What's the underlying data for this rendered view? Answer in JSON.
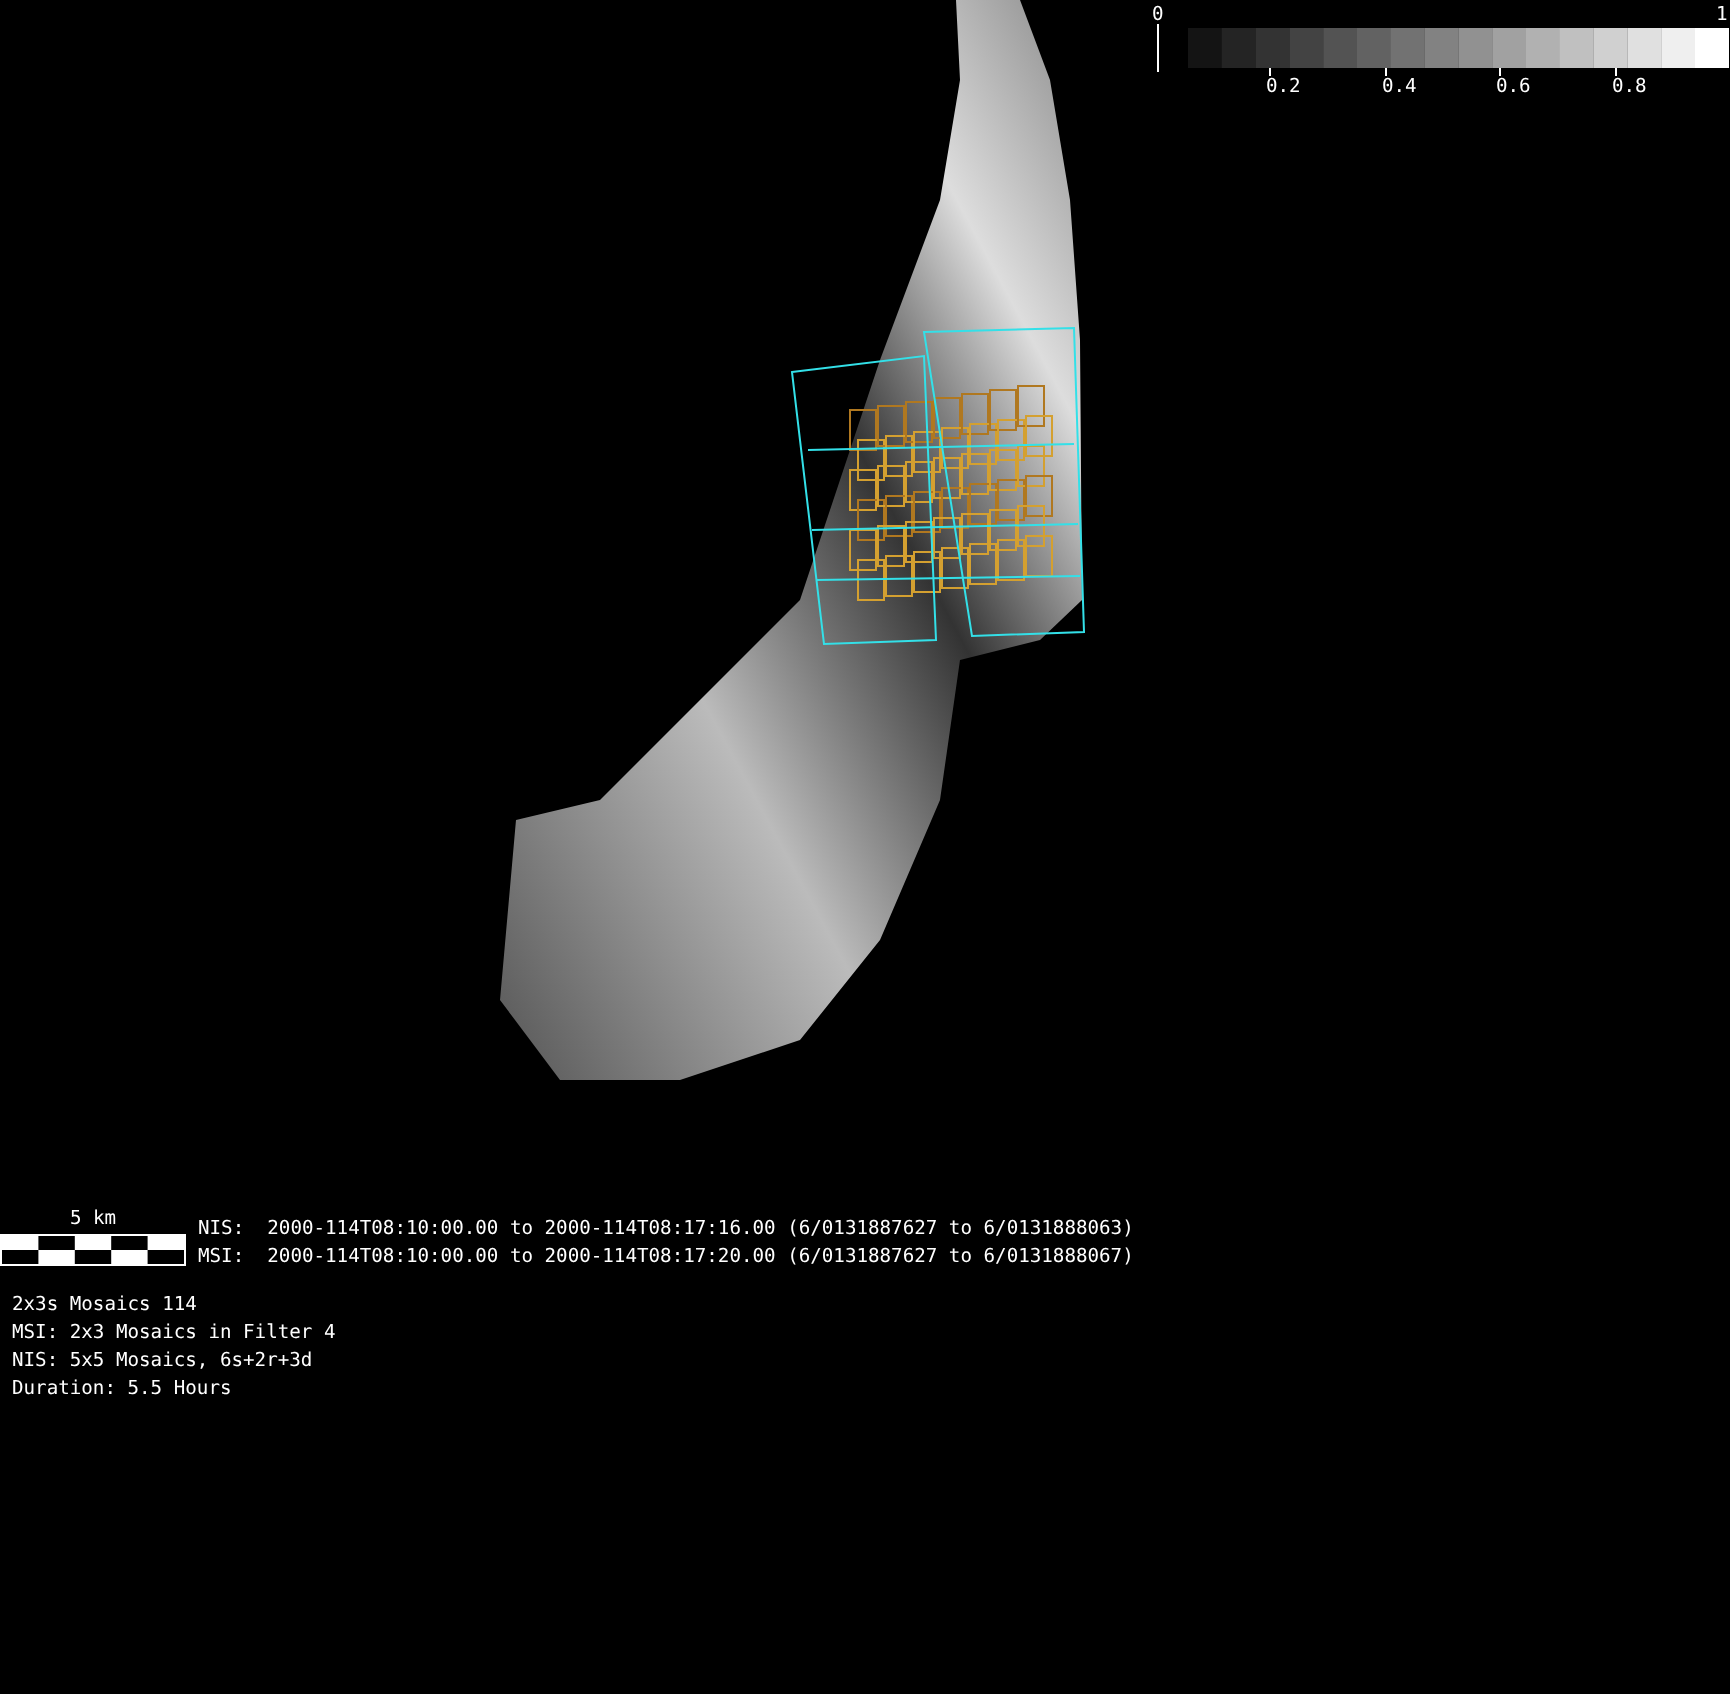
{
  "colorbar": {
    "min_label": "0",
    "max_label": "1",
    "ticks": [
      "0.2",
      "0.4",
      "0.6",
      "0.8"
    ]
  },
  "scale_bar": {
    "label": "5 km"
  },
  "time_ranges": [
    "NIS:  2000-114T08:10:00.00 to 2000-114T08:17:16.00 (6/0131887627 to 6/0131888063)",
    "MSI:  2000-114T08:10:00.00 to 2000-114T08:17:20.00 (6/0131887627 to 6/0131888067)"
  ],
  "info_lines": [
    "2x3s Mosaics 114",
    "MSI: 2x3 Mosaics in Filter 4",
    "NIS: 5x5 Mosaics, 6s+2r+3d",
    "Duration: 5.5 Hours"
  ]
}
